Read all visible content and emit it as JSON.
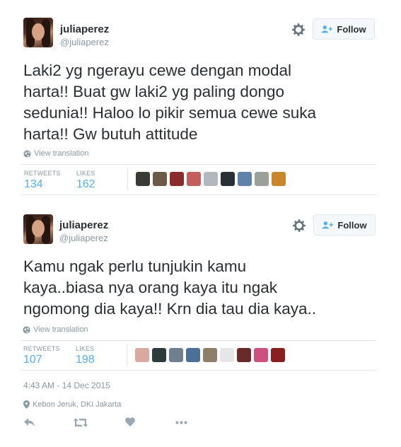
{
  "tweets": [
    {
      "name": "juliaperez",
      "handle": "@juliaperez",
      "follow_label": "Follow",
      "text": "Laki2 yg ngerayu cewe dengan modal\nharta!! Buat gw laki2 yg paling dongo\nsedunia!! Haloo lo pikir semua cewe suka\nharta!! Gw butuh attitude",
      "view_translation": "View translation",
      "retweets_label": "RETWEETS",
      "retweets": "134",
      "likes_label": "LIKES",
      "likes": "162",
      "liker_colors": [
        "#3b3b36",
        "#6b5a48",
        "#8a2c2c",
        "#c45f5f",
        "#b2b8bd",
        "#2b2f36",
        "#5f83a8",
        "#9aa09a",
        "#c9862d"
      ]
    },
    {
      "name": "juliaperez",
      "handle": "@juliaperez",
      "follow_label": "Follow",
      "text": "Kamu ngak perlu tunjukin kamu\nkaya..biasa nya orang kaya itu ngak\nngomong dia kaya!! Krn dia tau dia kaya..",
      "view_translation": "View translation",
      "retweets_label": "RETWEETS",
      "retweets": "107",
      "likes_label": "LIKES",
      "likes": "198",
      "liker_colors": [
        "#d9a8a0",
        "#2f3a3a",
        "#6f7f8f",
        "#4c6f96",
        "#8e7f6a",
        "#e6e6e6",
        "#6a2a2a",
        "#cf4f7f",
        "#8a1f1f"
      ],
      "timestamp": "4:43 AM - 14 Dec 2015",
      "location": "Kebon Jeruk, DKI Jakarta"
    }
  ],
  "icons": {
    "gear": "gear-icon",
    "follow": "follow-person-icon",
    "globe": "globe-icon",
    "reply": "reply-icon",
    "retweet": "retweet-icon",
    "like": "heart-icon",
    "more": "more-icon",
    "location": "location-pin-icon"
  },
  "colors": {
    "link_blue": "#55acee",
    "muted": "#8899a6",
    "text": "#292f33"
  }
}
